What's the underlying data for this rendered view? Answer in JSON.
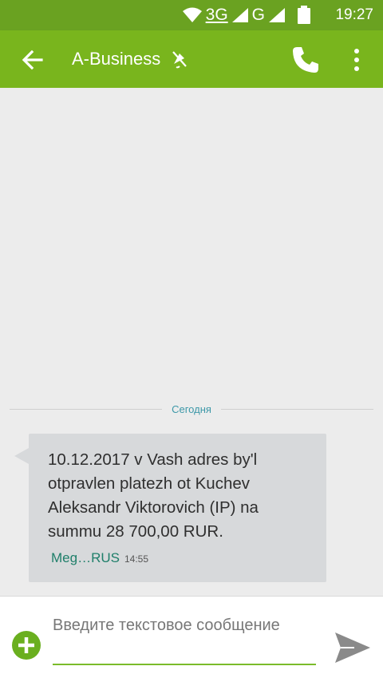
{
  "status_bar": {
    "network_1": "3G",
    "network_2": "G",
    "time": "19:27"
  },
  "app_bar": {
    "back_icon": "arrow-left-icon",
    "title": "A-Business",
    "muted_icon": "mute-icon",
    "call_icon": "phone-icon",
    "menu_icon": "more-vertical-icon"
  },
  "conversation": {
    "date_divider": "Сегодня",
    "messages": [
      {
        "text": "10.12.2017 v Vash adres by'l otpravlen platezh ot Kuchev Aleksandr Viktorovich (IP) na summu 28 700,00 RUR.",
        "sim": "Meg…RUS",
        "time": "14:55"
      }
    ]
  },
  "compose": {
    "placeholder": "Введите текстовое сообщение",
    "add_icon": "add-attachment-icon",
    "send_icon": "send-icon"
  },
  "colors": {
    "status_bar": "#6aa221",
    "app_bar": "#79b51d",
    "accent": "#7bbc2b",
    "bubble": "#d7d9db",
    "date_label": "#3d98a8"
  }
}
